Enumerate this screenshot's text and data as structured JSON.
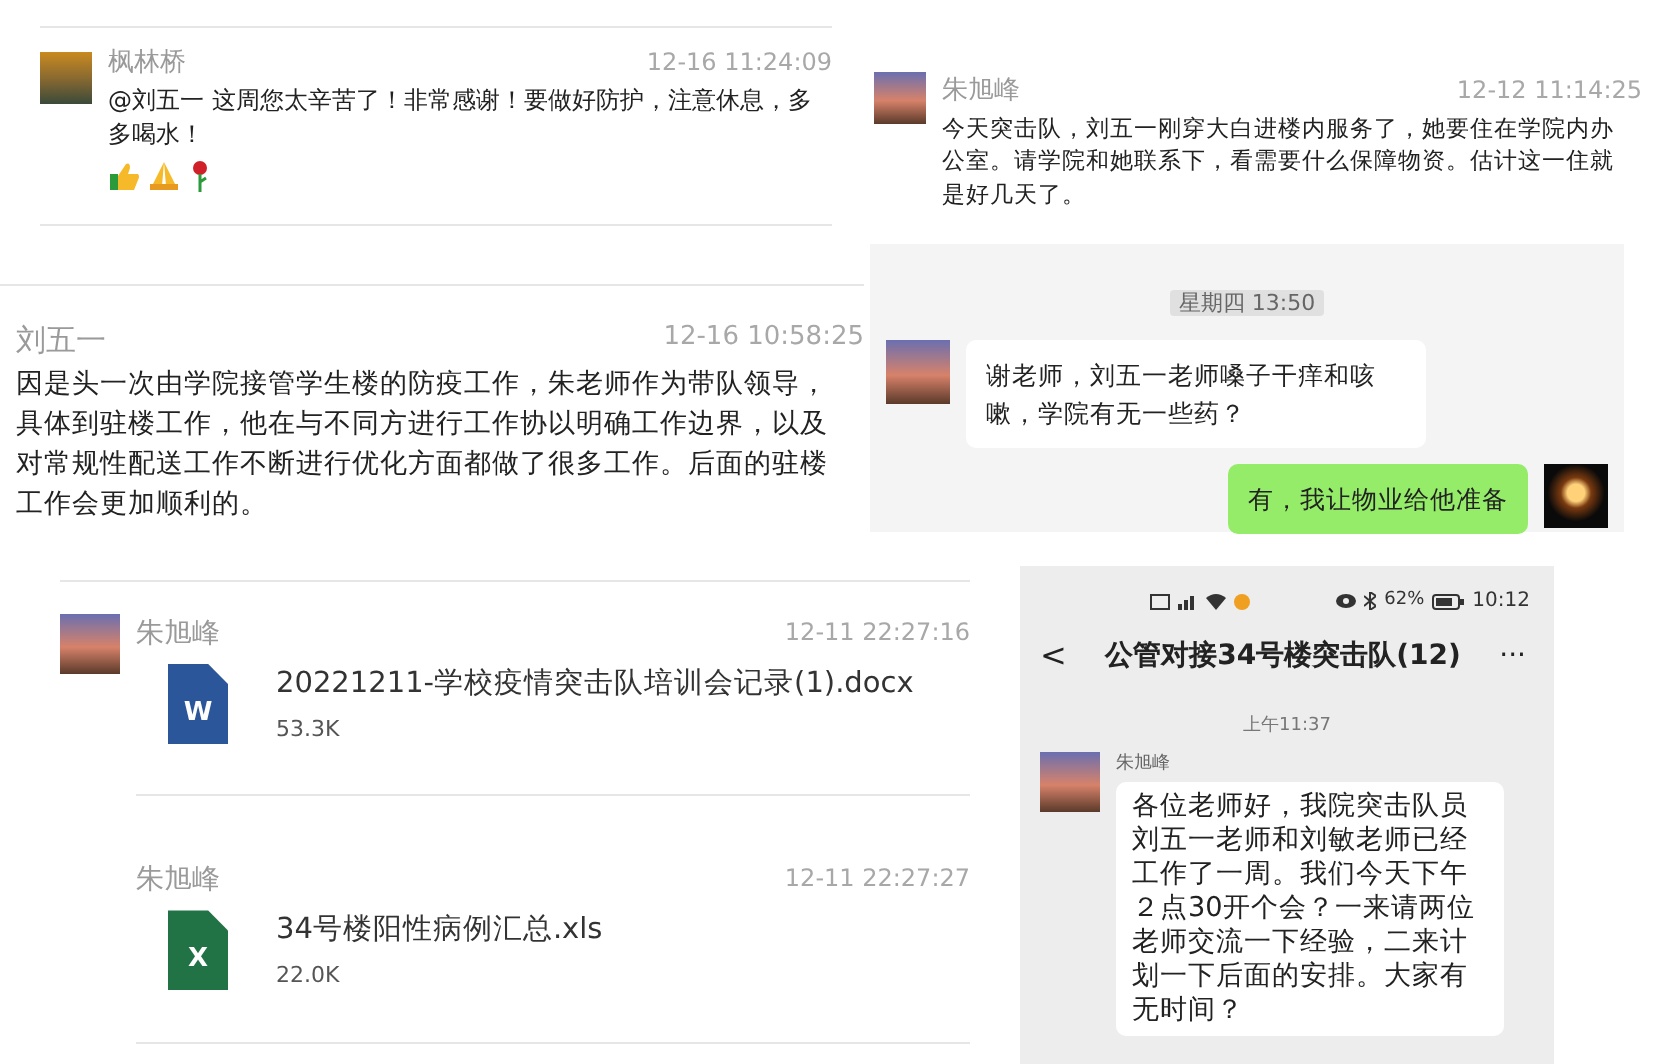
{
  "top_comment": {
    "author": "枫林桥",
    "time": "12-16 11:24:09",
    "text": "@刘五一 这周您太辛苦了！非常感谢！要做好防护，注意休息，多多喝水！"
  },
  "right_comment": {
    "author": "朱旭峰",
    "time": "12-12 11:14:25",
    "text": "今天突击队，刘五一刚穿大白进楼内服务了，她要住在学院内办公室。请学院和她联系下，看需要什么保障物资。估计这一住就是好几天了。"
  },
  "chat_window": {
    "time_divider": "星期四 13:50",
    "messages": [
      {
        "kind": "received",
        "text": "谢老师，刘五一老师嗓子干痒和咳嗽，学院有无一些药？"
      },
      {
        "kind": "sent",
        "text": "有，我让物业给他准备"
      }
    ]
  },
  "long_comment": {
    "author": "刘五一",
    "time": "12-16 10:58:25",
    "text": "因是头一次由学院接管学生楼的防疫工作，朱老师作为带队领导，具体到驻楼工作，他在与不同方进行工作协以明确工作边界，以及对常规性配送工作不断进行优化方面都做了很多工作。后面的驻楼工作会更加顺利的。"
  },
  "file_messages": [
    {
      "author": "朱旭峰",
      "time": "12-11 22:27:16",
      "show_avatar": true,
      "icon_letter": "W",
      "color": "#2b579a",
      "file_name": "20221211-学校疫情突击队培训会记录(1).docx",
      "file_size": "53.3K"
    },
    {
      "author": "朱旭峰",
      "time": "12-11 22:27:27",
      "show_avatar": false,
      "icon_letter": "X",
      "color": "#217346",
      "file_name": "34号楼阳性病例汇总.xls",
      "file_size": "22.0K"
    }
  ],
  "phone_chat": {
    "battery": "62%",
    "clock": "10:12",
    "back": "<",
    "title": "公管对接34号楼突击队(12)",
    "more": "···",
    "time_divider": "上午11:37",
    "author": "朱旭峰",
    "text": "各位老师好，我院突击队员刘五一老师和刘敏老师已经工作了一周。我们今天下午２点30开个会？一来请两位老师交流一下经验，二来计划一下后面的安排。大家有无时间？"
  }
}
